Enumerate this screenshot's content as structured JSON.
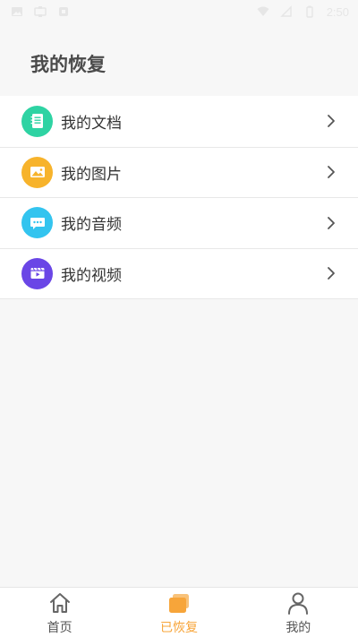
{
  "status_bar": {
    "time": "2:50",
    "icons_left": [
      "image-icon",
      "usb-icon",
      "notification-icon"
    ],
    "icons_right": [
      "wifi-icon",
      "signal-icon",
      "battery-icon"
    ]
  },
  "page": {
    "title": "我的恢复"
  },
  "menu": {
    "items": [
      {
        "label": "我的文档",
        "icon": "document-icon",
        "color": "#2ed3a3"
      },
      {
        "label": "我的图片",
        "icon": "picture-icon",
        "color": "#f7b32b"
      },
      {
        "label": "我的音频",
        "icon": "audio-icon",
        "color": "#33c4ef"
      },
      {
        "label": "我的视频",
        "icon": "video-icon",
        "color": "#6a46e6"
      }
    ]
  },
  "tab_bar": {
    "tabs": [
      {
        "label": "首页",
        "icon": "home-icon",
        "active": false
      },
      {
        "label": "已恢复",
        "icon": "restored-icon",
        "active": true
      },
      {
        "label": "我的",
        "icon": "user-icon",
        "active": false
      }
    ],
    "active_color": "#f7a53a"
  }
}
